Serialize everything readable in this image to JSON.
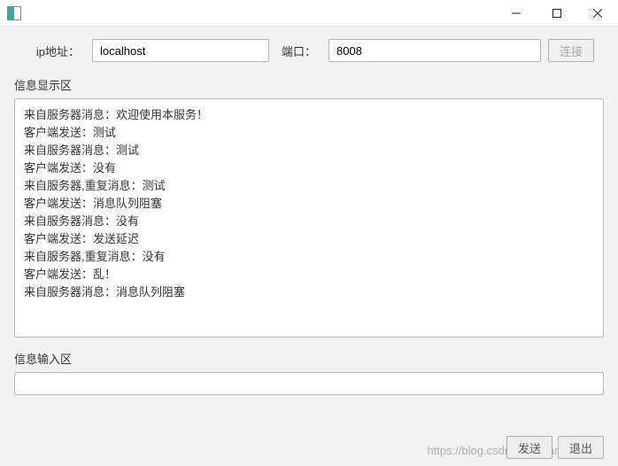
{
  "titlebar": {
    "app_icon_name": "app-icon"
  },
  "connection": {
    "ip_label": "ip地址：",
    "ip_value": "localhost",
    "port_label": "端口：",
    "port_value": "8008",
    "connect_label": "连接"
  },
  "display": {
    "section_label": "信息显示区",
    "lines": [
      "来自服务器消息：欢迎使用本服务！",
      "客户端发送：测试",
      "来自服务器消息：测试",
      "客户端发送：没有",
      "来自服务器,重复消息：测试",
      "客户端发送：消息队列阻塞",
      "来自服务器消息：没有",
      "客户端发送：发送延迟",
      "来自服务器,重复消息：没有",
      "客户端发送：乱！",
      "来自服务器消息：消息队列阻塞"
    ]
  },
  "input": {
    "section_label": "信息输入区",
    "value": ""
  },
  "actions": {
    "send_label": "发送",
    "exit_label": "退出"
  },
  "watermark": "https://blog.csdn.net/Charzous"
}
